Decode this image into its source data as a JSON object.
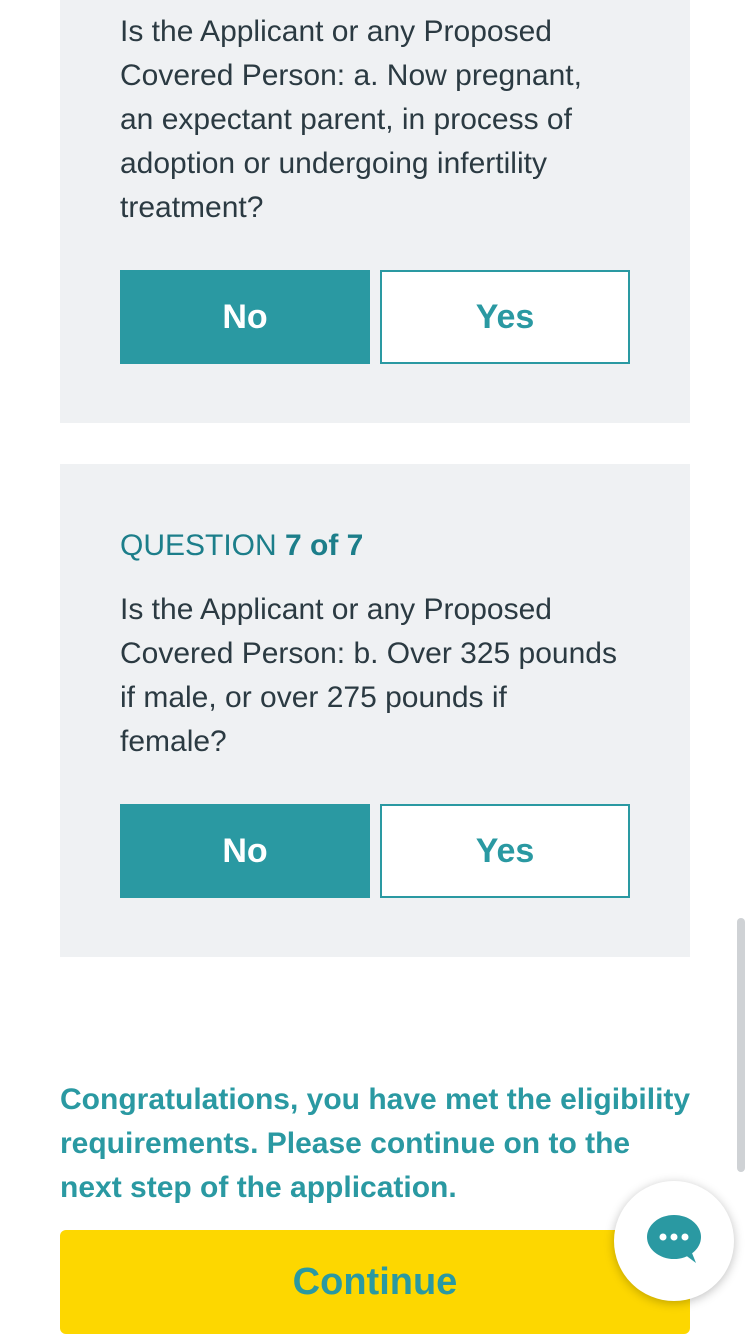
{
  "questions": [
    {
      "text": "Is the Applicant or any Proposed Covered Person: a. Now pregnant, an expectant parent, in process of adoption or undergoing infertility treatment?",
      "no_label": "No",
      "yes_label": "Yes",
      "selected": "No"
    },
    {
      "label_prefix": "QUESTION ",
      "label_number": "7 of 7",
      "text": "Is the Applicant or any Proposed Covered Person: b. Over 325 pounds if male, or over 275 pounds if female?",
      "no_label": "No",
      "yes_label": "Yes",
      "selected": "No"
    }
  ],
  "congrats_message": "Congratulations, you have met the eligibility requirements. Please continue on to the next step of the application.",
  "continue_label": "Continue",
  "chat_widget": {
    "icon": "chat-bubble-icon"
  },
  "colors": {
    "accent": "#2a99a2",
    "card_background": "#eff1f3",
    "continue_button": "#fdd700",
    "label_text": "#1c7e8a"
  }
}
